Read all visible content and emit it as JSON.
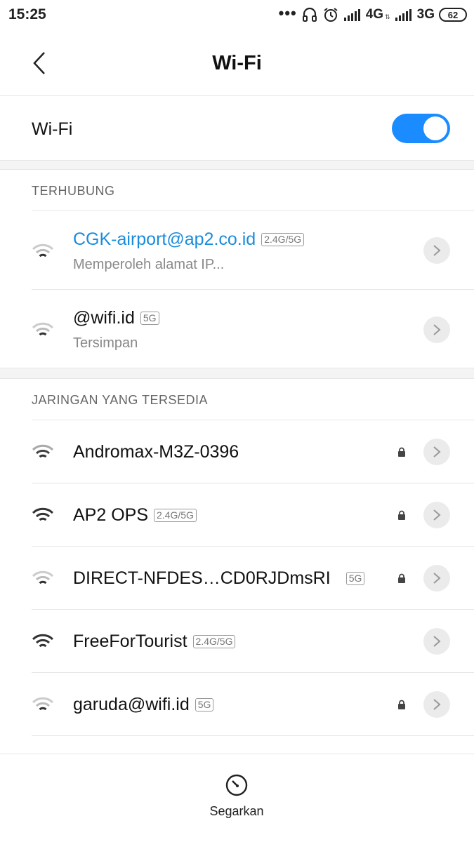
{
  "status_bar": {
    "time": "15:25",
    "dots": "•••",
    "net1": "4G",
    "net1_small": "⇅",
    "net2": "3G",
    "battery": "62"
  },
  "header": {
    "title": "Wi-Fi"
  },
  "toggle": {
    "label": "Wi-Fi",
    "on": true
  },
  "connected_section": {
    "title": "TERHUBUNG",
    "items": [
      {
        "name": "CGK-airport@ap2.co.id",
        "band": "2.4G/5G",
        "status": "Memperoleh alamat IP..."
      },
      {
        "name": "@wifi.id",
        "band": "5G",
        "status": "Tersimpan"
      }
    ]
  },
  "available_section": {
    "title": "JARINGAN YANG TERSEDIA",
    "items": [
      {
        "name": "Andromax-M3Z-0396",
        "band": "",
        "locked": true
      },
      {
        "name": "AP2 OPS",
        "band": "2.4G/5G",
        "locked": true
      },
      {
        "name": "DIRECT-NFDES…CD0RJDmsRI",
        "band": "5G",
        "locked": true
      },
      {
        "name": "FreeForTourist",
        "band": "2.4G/5G",
        "locked": false
      },
      {
        "name": "garuda@wifi.id",
        "band": "5G",
        "locked": true
      }
    ]
  },
  "bottom": {
    "refresh_label": "Segarkan"
  },
  "colors": {
    "accent": "#1a8cff",
    "link": "#1a8cdb"
  }
}
